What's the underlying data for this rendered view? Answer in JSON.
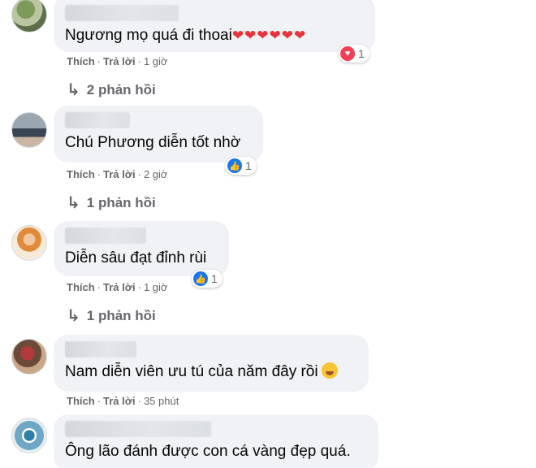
{
  "comments": [
    {
      "text": "Ngương mọ quá đi thoai",
      "hearts": "❤❤❤❤❤❤",
      "reaction_type": "heart",
      "reaction_count": "1",
      "like_label": "Thích",
      "reply_label": "Trả lời",
      "time": "1 giờ",
      "replies_label": "2 phản hồi"
    },
    {
      "text": "Chú Phương diễn tốt nhờ",
      "reaction_type": "like",
      "reaction_count": "1",
      "like_label": "Thích",
      "reply_label": "Trả lời",
      "time": "2 giờ",
      "replies_label": "1 phản hồi"
    },
    {
      "text": "Diễn sâu đạt đỉnh rùi",
      "reaction_type": "like",
      "reaction_count": "1",
      "like_label": "Thích",
      "reply_label": "Trả lời",
      "time": "1 giờ",
      "replies_label": "1 phản hồi"
    },
    {
      "text": "Nam diễn viên ưu tú của năm đây rồi",
      "emoji": "grinning-face-with-tongue",
      "like_label": "Thích",
      "reply_label": "Trả lời",
      "time": "35 phút"
    },
    {
      "text": "Ông lão đánh được con cá vàng đẹp quá."
    }
  ],
  "colors": {
    "bubble_bg": "#f0f2f5",
    "meta_text": "#65676b",
    "like_blue": "#1877f2",
    "heart_red": "#f33e58"
  }
}
